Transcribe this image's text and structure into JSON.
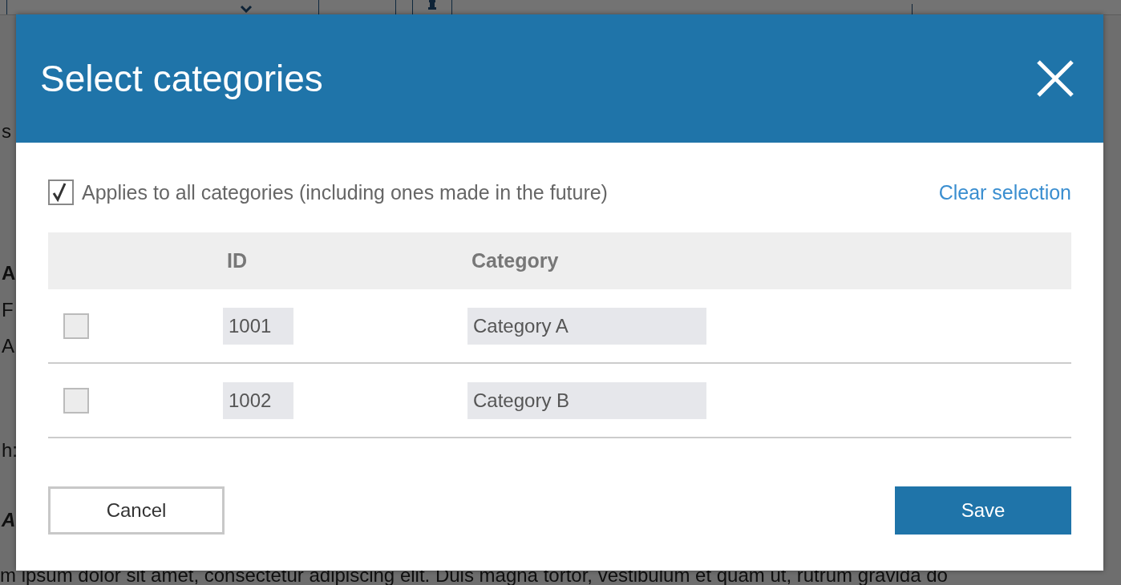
{
  "background": {
    "fragments": [
      {
        "text": "s",
        "kind": "plain"
      },
      {
        "text": "A",
        "kind": "bold"
      },
      {
        "text": "F",
        "kind": "plain"
      },
      {
        "text": "A",
        "kind": "plain"
      },
      {
        "text": "h:",
        "kind": "plain"
      },
      {
        "text": "A",
        "kind": "bold-italic"
      }
    ],
    "body_line": "m ipsum dolor sit amet, consectetur adipiscing elit. Duis magna tortor, vestibulum et quam ut, rutrum gravida do"
  },
  "dialog": {
    "title": "Select categories",
    "applies_all": {
      "label": "Applies to all categories (including ones made in the future)",
      "checked": true
    },
    "clear": "Clear selection",
    "columns": [
      "ID",
      "Category"
    ],
    "rows": [
      {
        "id": "1001",
        "category": "Category A",
        "checked": false
      },
      {
        "id": "1002",
        "category": "Category B",
        "checked": false
      }
    ],
    "buttons": [
      {
        "label": "Cancel",
        "kind": "secondary"
      },
      {
        "label": "Save",
        "kind": "primary"
      }
    ]
  }
}
